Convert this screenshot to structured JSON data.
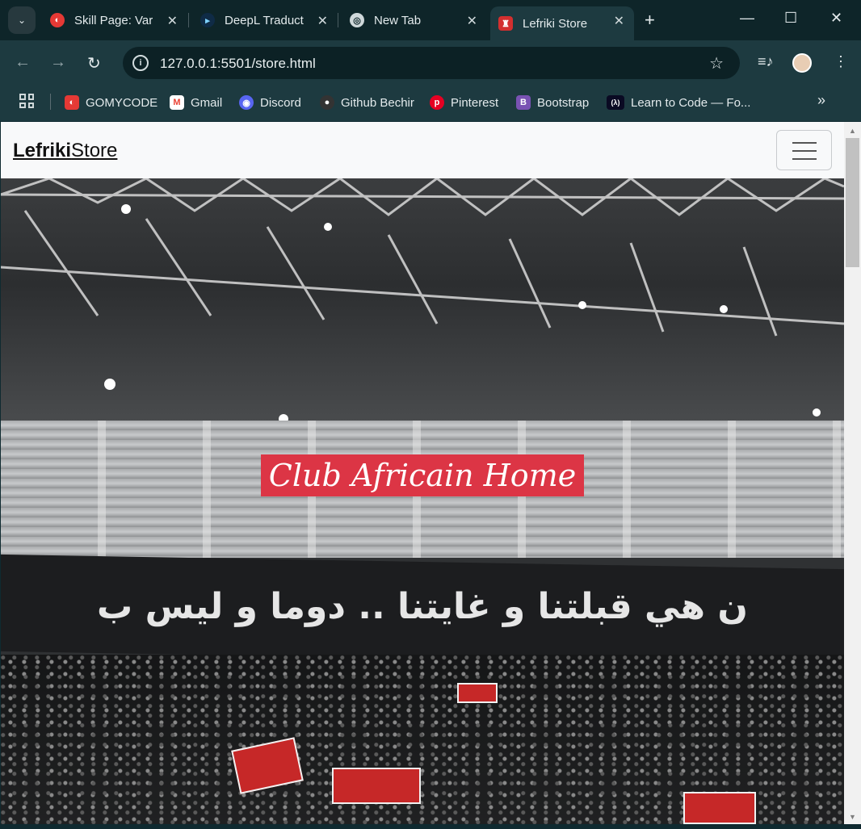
{
  "browser": {
    "tabs": [
      {
        "title": "Skill Page: Vari",
        "icon": "gomycode-icon",
        "color": "#e53935"
      },
      {
        "title": "DeepL Traduct",
        "icon": "deepl-icon",
        "color": "#0f2b46"
      },
      {
        "title": "New Tab",
        "icon": "chrome-icon",
        "color": "#cfd8da"
      },
      {
        "title": "Lefriki Store",
        "icon": "club-africain-icon",
        "color": "#d32f2f"
      }
    ],
    "url": "127.0.0.1:5501/store.html",
    "bookmarks": [
      {
        "label": "GOMYCODE",
        "color": "#e53935",
        "glyph": "◐"
      },
      {
        "label": "Gmail",
        "color": "#ea4335",
        "glyph": "M"
      },
      {
        "label": "Discord",
        "color": "#5865f2",
        "glyph": "◉"
      },
      {
        "label": "Github Bechir",
        "color": "#333333",
        "glyph": "●"
      },
      {
        "label": "Pinterest",
        "color": "#e60023",
        "glyph": "p"
      },
      {
        "label": "Bootstrap",
        "color": "#7952b3",
        "glyph": "B"
      },
      {
        "label": "Learn to Code — Fo...",
        "color": "#0a0a23",
        "glyph": "(λ)"
      }
    ]
  },
  "page": {
    "brand_bold": "Lefriki",
    "brand_rest": "Store",
    "hero_title": "Club Africain Home",
    "banner_text": "ن هي قبلتنا و غايتنا .. دوما و ليس ب"
  },
  "colors": {
    "hero_title_bg": "#dc3545",
    "navbar_bg": "#f8f9fa"
  }
}
